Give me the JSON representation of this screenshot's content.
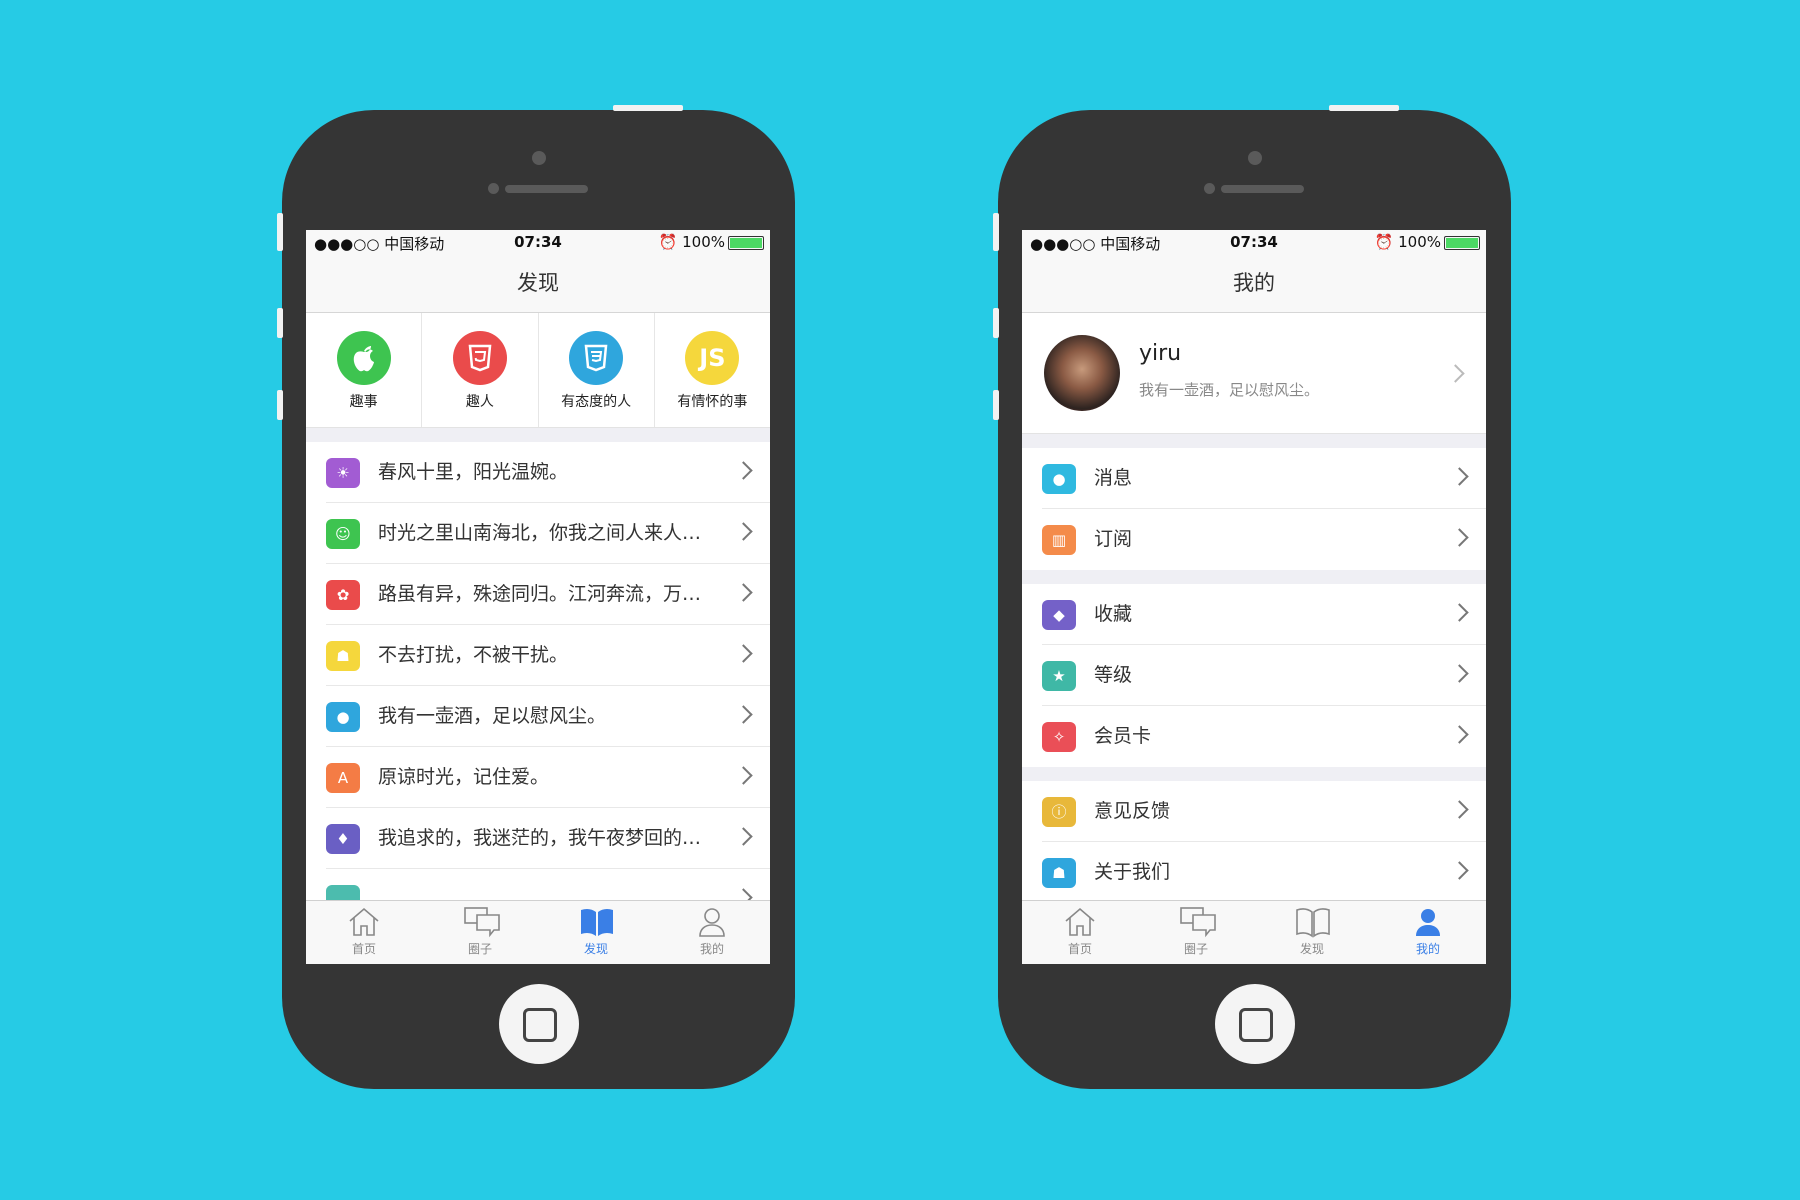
{
  "status_bar": {
    "carrier": "●●●○○ 中国移动",
    "time": "07:34",
    "battery": "100%"
  },
  "discover": {
    "title": "发现",
    "grid": [
      {
        "label": "趣事",
        "icon": "apple-icon",
        "color": "#3ec450",
        "glyph": ""
      },
      {
        "label": "趣人",
        "icon": "html5-icon",
        "color": "#ea4b4b",
        "glyph": "5"
      },
      {
        "label": "有态度的人",
        "icon": "css3-icon",
        "color": "#2fa6dd",
        "glyph": "3"
      },
      {
        "label": "有情怀的事",
        "icon": "js-icon",
        "color": "#f5d73c",
        "glyph": "JS"
      }
    ],
    "rows": [
      {
        "text": "春风十里，阳光温婉。",
        "icon": "sun-icon",
        "color": "#a25cd3",
        "glyph": "☀"
      },
      {
        "text": "时光之里山南海北，你我之间人来人往。",
        "icon": "smile-icon",
        "color": "#3ec450",
        "glyph": "☺"
      },
      {
        "text": "路虽有异，殊途同归。江河奔流，万象归宗。",
        "icon": "paw-icon",
        "color": "#ea4b4b",
        "glyph": "✿"
      },
      {
        "text": "不去打扰，不被干扰。",
        "icon": "ghost-icon",
        "color": "#f5d73c",
        "glyph": "☗"
      },
      {
        "text": "我有一壶酒，足以慰风尘。",
        "icon": "github-icon",
        "color": "#2fa6dd",
        "glyph": "●"
      },
      {
        "text": "原谅时光，记住爱。",
        "icon": "angular-icon",
        "color": "#f47c45",
        "glyph": "A"
      },
      {
        "text": "我追求的，我迷茫的，我午夜梦回的……",
        "icon": "flame-icon",
        "color": "#6a5fc4",
        "glyph": "♦"
      },
      {
        "text": "",
        "icon": "extra-icon",
        "color": "#4cbcae",
        "glyph": ""
      }
    ]
  },
  "mine": {
    "title": "我的",
    "profile": {
      "name": "yiru",
      "signature": "我有一壶酒，足以慰风尘。"
    },
    "groups": [
      [
        {
          "text": "消息",
          "icon": "message-icon",
          "color": "#2fb9e0",
          "glyph": "●"
        },
        {
          "text": "订阅",
          "icon": "book-icon",
          "color": "#f48b4a",
          "glyph": "▥"
        }
      ],
      [
        {
          "text": "收藏",
          "icon": "tag-icon",
          "color": "#7461c8",
          "glyph": "◆"
        },
        {
          "text": "等级",
          "icon": "star-icon",
          "color": "#3fb8a6",
          "glyph": "★"
        },
        {
          "text": "会员卡",
          "icon": "wand-icon",
          "color": "#ea4f57",
          "glyph": "✧"
        }
      ],
      [
        {
          "text": "意见反馈",
          "icon": "info-icon",
          "color": "#e8b83a",
          "glyph": "ⓘ"
        },
        {
          "text": "关于我们",
          "icon": "users-icon",
          "color": "#2fa6dd",
          "glyph": "☗"
        }
      ]
    ]
  },
  "tabbar": [
    "首页",
    "圈子",
    "发现",
    "我的"
  ],
  "colors": {
    "background": "#26cbe5",
    "accent": "#3a7fe6",
    "phone": "#353535"
  }
}
